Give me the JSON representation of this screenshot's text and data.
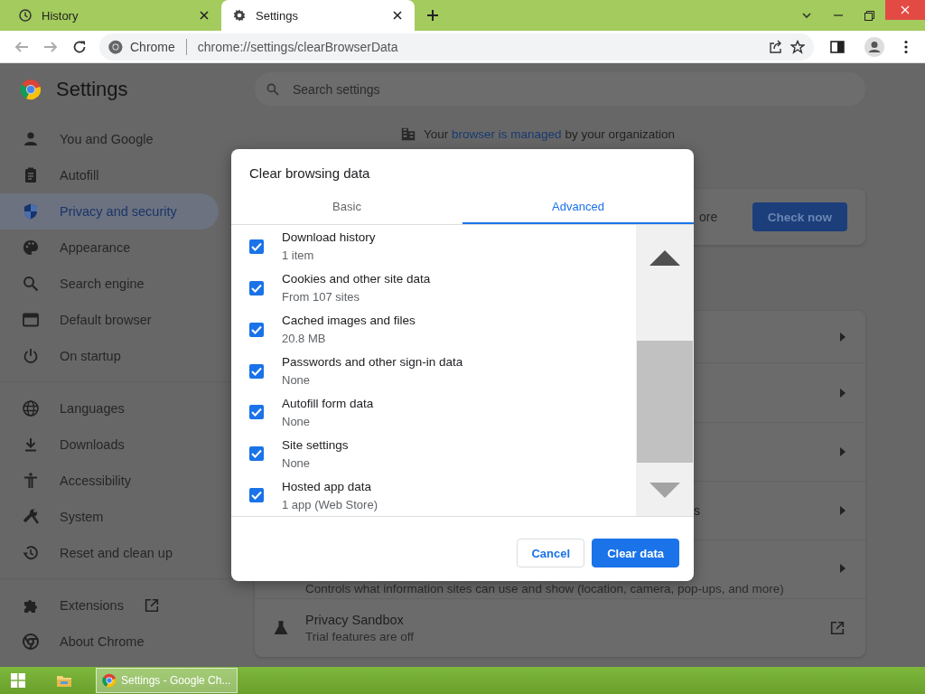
{
  "tabs": [
    {
      "title": "History",
      "selected": false
    },
    {
      "title": "Settings",
      "selected": true
    }
  ],
  "toolbar": {
    "site_label": "Chrome",
    "url": "chrome://settings/clearBrowserData"
  },
  "settings": {
    "title": "Settings",
    "search": {
      "placeholder": "Search settings"
    },
    "sidebar": {
      "groups": [
        {
          "items": [
            {
              "label": "You and Google",
              "kind": "page",
              "selected": false
            },
            {
              "label": "Autofill",
              "kind": "page",
              "selected": false
            },
            {
              "label": "Privacy and security",
              "kind": "page",
              "selected": true
            },
            {
              "label": "Appearance",
              "kind": "page",
              "selected": false
            },
            {
              "label": "Search engine",
              "kind": "page",
              "selected": false
            },
            {
              "label": "Default browser",
              "kind": "page",
              "selected": false
            },
            {
              "label": "On startup",
              "kind": "page",
              "selected": false
            }
          ]
        },
        {
          "items": [
            {
              "label": "Languages",
              "kind": "page",
              "selected": false
            },
            {
              "label": "Downloads",
              "kind": "page",
              "selected": false
            },
            {
              "label": "Accessibility",
              "kind": "page",
              "selected": false
            },
            {
              "label": "System",
              "kind": "page",
              "selected": false
            },
            {
              "label": "Reset and clean up",
              "kind": "page",
              "selected": false
            }
          ]
        },
        {
          "items": [
            {
              "label": "Extensions",
              "kind": "external",
              "selected": false
            },
            {
              "label": "About Chrome",
              "kind": "page",
              "selected": false
            }
          ]
        }
      ]
    },
    "managed_notice": {
      "before": "Your",
      "link": "browser is managed",
      "after": "by your organization"
    },
    "safety_check": {
      "text_fragment": "ore",
      "button": "Check now"
    },
    "privacy_rows": [
      {
        "kind": "arrow"
      },
      {
        "kind": "arrow"
      },
      {
        "kind": "arrow"
      },
      {
        "kind": "arrow",
        "title_fragment": "s"
      },
      {
        "kind": "arrow",
        "subtitle": "Controls what information sites can use and show (location, camera, pop-ups, and more)"
      },
      {
        "kind": "external",
        "title": "Privacy Sandbox",
        "subtitle": "Trial features are off"
      }
    ]
  },
  "dialog": {
    "title": "Clear browsing data",
    "tabs": [
      {
        "label": "Basic",
        "selected": false
      },
      {
        "label": "Advanced",
        "selected": true
      }
    ],
    "items": [
      {
        "title": "Download history",
        "detail": "1 item",
        "checked": true
      },
      {
        "title": "Cookies and other site data",
        "detail": "From 107 sites",
        "checked": true
      },
      {
        "title": "Cached images and files",
        "detail": "20.8 MB",
        "checked": true
      },
      {
        "title": "Passwords and other sign-in data",
        "detail": "None",
        "checked": true
      },
      {
        "title": "Autofill form data",
        "detail": "None",
        "checked": true
      },
      {
        "title": "Site settings",
        "detail": "None",
        "checked": true
      },
      {
        "title": "Hosted app data",
        "detail": "1 app (Web Store)",
        "checked": true
      }
    ],
    "buttons": [
      {
        "label": "Cancel",
        "kind": "secondary"
      },
      {
        "label": "Clear data",
        "kind": "primary"
      }
    ]
  },
  "taskbar": {
    "apps": [
      {
        "title": "Settings - Google Ch...",
        "selected": true
      }
    ]
  }
}
